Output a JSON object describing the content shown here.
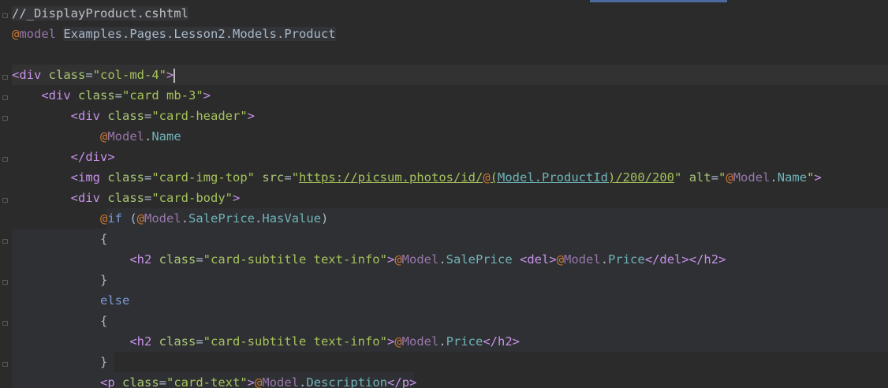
{
  "editor": {
    "filename_comment": "//_DisplayProduct.cshtml",
    "lines": [
      {
        "t": "//_DisplayProduct.cshtml"
      },
      {
        "t": "@model Examples.Pages.Lesson2.Models.Product"
      },
      {
        "t": ""
      },
      {
        "t": "<div class=\"col-md-4\">"
      },
      {
        "t": "    <div class=\"card mb-3\">"
      },
      {
        "t": "        <div class=\"card-header\">"
      },
      {
        "t": "            @Model.Name"
      },
      {
        "t": "        </div>"
      },
      {
        "t": "        <img class=\"card-img-top\" src=\"https://picsum.photos/id/@(Model.ProductId)/200/200\" alt=\"@Model.Name\">"
      },
      {
        "t": "        <div class=\"card-body\">"
      },
      {
        "t": "            @if (@Model.SalePrice.HasValue)"
      },
      {
        "t": "            {"
      },
      {
        "t": "                <h2 class=\"card-subtitle text-info\">@Model.SalePrice <del>@Model.Price</del></h2>"
      },
      {
        "t": "            }"
      },
      {
        "t": "            else"
      },
      {
        "t": "            {"
      },
      {
        "t": "                <h2 class=\"card-subtitle text-info\">@Model.Price</h2>"
      },
      {
        "t": "            }"
      },
      {
        "t": "            <p class=\"card-text\">@Model.Description</p>"
      }
    ]
  },
  "colors": {
    "background": "#2b2b2b",
    "tag": "#e8bf6a",
    "string": "#a5c25c",
    "property": "#6fb3b8",
    "keyword": "#7a98d6"
  }
}
